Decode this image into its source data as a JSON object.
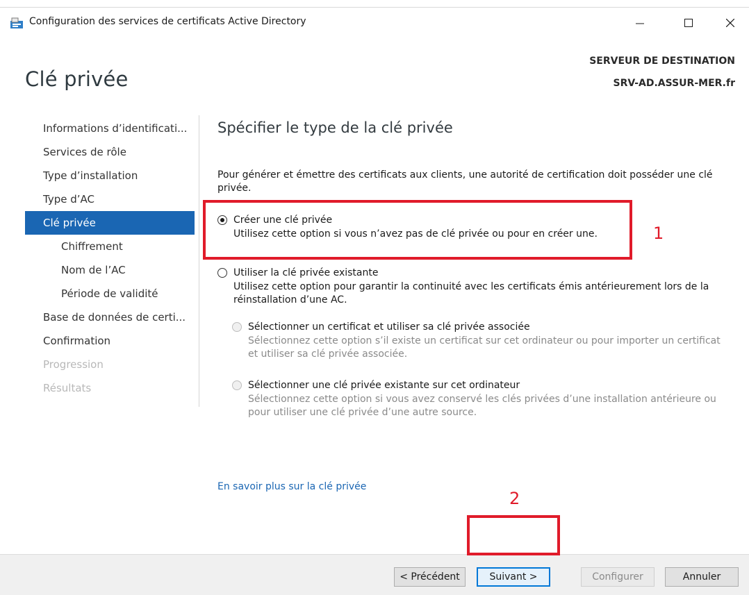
{
  "window": {
    "title": "Configuration des services de certificats Active Directory",
    "icon": "server-role-icon"
  },
  "header": {
    "page_title": "Clé privée",
    "destination_label": "SERVEUR DE DESTINATION",
    "destination_server": "SRV-AD.ASSUR-MER.fr"
  },
  "nav": {
    "items": [
      {
        "label": "Informations d’identificati...",
        "state": "normal"
      },
      {
        "label": "Services de rôle",
        "state": "normal"
      },
      {
        "label": "Type d’installation",
        "state": "normal"
      },
      {
        "label": "Type d’AC",
        "state": "normal"
      },
      {
        "label": "Clé privée",
        "state": "active"
      },
      {
        "label": "Chiffrement",
        "state": "sub"
      },
      {
        "label": "Nom de l’AC",
        "state": "sub"
      },
      {
        "label": "Période de validité",
        "state": "sub"
      },
      {
        "label": "Base de données de certi...",
        "state": "normal"
      },
      {
        "label": "Confirmation",
        "state": "normal"
      },
      {
        "label": "Progression",
        "state": "disabled"
      },
      {
        "label": "Résultats",
        "state": "disabled"
      }
    ]
  },
  "content": {
    "section_title": "Spécifier le type de la clé privée",
    "intro": "Pour générer et émettre des certificats aux clients, une autorité de certification doit posséder une clé privée.",
    "option_create": {
      "label": "Créer une clé privée",
      "description": "Utilisez cette option si vous n’avez pas de clé privée ou pour en créer une.",
      "selected": true
    },
    "option_existing": {
      "label": "Utiliser la clé privée existante",
      "description": "Utilisez cette option pour garantir la continuité avec les certificats émis antérieurement lors de la réinstallation d’une AC.",
      "selected": false
    },
    "option_cert": {
      "label": "Sélectionner un certificat et utiliser sa clé privée associée",
      "description": "Sélectionnez cette option s’il existe un certificat sur cet ordinateur ou pour importer un certificat et utiliser sa clé privée associée."
    },
    "option_key": {
      "label": "Sélectionner une clé privée existante sur cet ordinateur",
      "description": "Sélectionnez cette option si vous avez conservé les clés privées d’une installation antérieure ou pour utiliser une clé privée d’une autre source."
    },
    "learn_more": "En savoir plus sur la clé privée"
  },
  "annotations": {
    "step1": "1",
    "step2": "2",
    "color": "#e01b2a"
  },
  "footer": {
    "prev": "< Précédent",
    "next": "Suivant >",
    "configure": "Configurer",
    "cancel": "Annuler"
  },
  "colors": {
    "accent": "#1a66b3",
    "link": "#1a66b3",
    "highlight": "#e01b2a"
  }
}
